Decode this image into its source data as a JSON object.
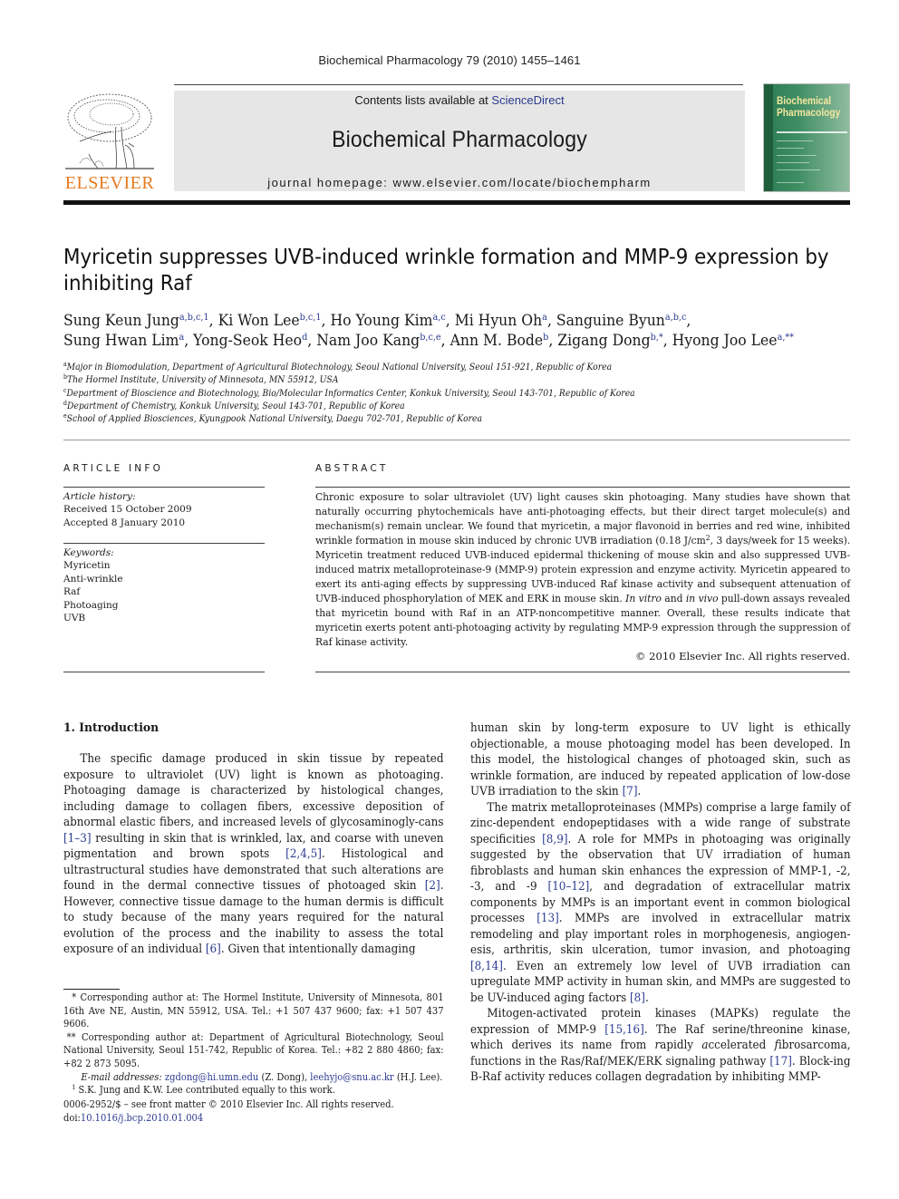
{
  "header": {
    "citation": "Biochemical Pharmacology 79 (2010) 1455–1461",
    "contents_prefix": "Contents lists available at ",
    "contents_link": "ScienceDirect",
    "journal_name": "Biochemical Pharmacology",
    "homepage": "journal homepage: www.elsevier.com/locate/biochempharm",
    "publisher_logo_text": "ELSEVIER",
    "cover": {
      "title_line1": "Biochemical",
      "title_line2": "Pharmacology"
    }
  },
  "colors": {
    "link": "#2b3a8f",
    "elsevier_orange": "#e67a1e",
    "masthead_band": "#e6e6e6",
    "cover_green": "#3f8e63"
  },
  "article": {
    "title": "Myricetin suppresses UVB-induced wrinkle formation and MMP-9 expression by inhibiting Raf",
    "authors": [
      {
        "name": "Sung Keun Jung",
        "sup": "a,b,c,1"
      },
      {
        "name": "Ki Won Lee",
        "sup": "b,c,1"
      },
      {
        "name": "Ho Young Kim",
        "sup": "a,c"
      },
      {
        "name": "Mi Hyun Oh",
        "sup": "a"
      },
      {
        "name": "Sanguine Byun",
        "sup": "a,b,c"
      },
      {
        "name": "Sung Hwan Lim",
        "sup": "a"
      },
      {
        "name": "Yong-Seok Heo",
        "sup": "d"
      },
      {
        "name": "Nam Joo Kang",
        "sup": "b,c,e"
      },
      {
        "name": "Ann M. Bode",
        "sup": "b"
      },
      {
        "name": "Zigang Dong",
        "sup": "b,*"
      },
      {
        "name": "Hyong Joo Lee",
        "sup": "a,**"
      }
    ],
    "affiliations": [
      {
        "key": "a",
        "text": "Major in Biomodulation, Department of Agricultural Biotechnology, Seoul National University, Seoul 151-921, Republic of Korea"
      },
      {
        "key": "b",
        "text": "The Hormel Institute, University of Minnesota, MN 55912, USA"
      },
      {
        "key": "c",
        "text": "Department of Bioscience and Biotechnology, Bio/Molecular Informatics Center, Konkuk University, Seoul 143-701, Republic of Korea"
      },
      {
        "key": "d",
        "text": "Department of Chemistry, Konkuk University, Seoul 143-701, Republic of Korea"
      },
      {
        "key": "e",
        "text": "School of Applied Biosciences, Kyungpook National University, Daegu 702-701, Republic of Korea"
      }
    ]
  },
  "article_info": {
    "heading": "ARTICLE INFO",
    "history_label": "Article history:",
    "received": "Received 15 October 2009",
    "accepted": "Accepted 8 January 2010",
    "keywords_label": "Keywords:",
    "keywords": [
      "Myricetin",
      "Anti-wrinkle",
      "Raf",
      "Photoaging",
      "UVB"
    ]
  },
  "abstract": {
    "heading": "ABSTRACT",
    "part1": "Chronic exposure to solar ultraviolet (UV) light causes skin photoaging. Many studies have shown that naturally occurring phytochemicals have anti-photoaging effects, but their direct target molecule(s) and mechanism(s) remain unclear. We found that myricetin, a major flavonoid in berries and red wine, inhibited wrinkle formation in mouse skin induced by chronic UVB irradiation (0.18 J/cm",
    "sup": "2",
    "part2": ", 3 days/week for 15 weeks). Myricetin treatment reduced UVB-induced epidermal thickening of mouse skin and also suppressed UVB-induced matrix metalloproteinase-9 (MMP-9) protein expression and enzyme activity. Myricetin appeared to exert its anti-aging effects by suppressing UVB-induced Raf kinase activity and subsequent attenuation of UVB-induced phosphorylation of MEK and ERK in mouse skin. ",
    "italic1": "In vitro",
    "and": " and ",
    "italic2": "in vivo",
    "part3": " pull-down assays revealed that myricetin bound with Raf in an ATP-noncompetitive manner. Overall, these results indicate that myricetin exerts potent anti-photoaging activity by regulating MMP-9 expression through the suppression of Raf kinase activity.",
    "copyright": "© 2010 Elsevier Inc. All rights reserved."
  },
  "body": {
    "section_heading": "1. Introduction",
    "left_para": [
      {
        "t": "The specific damage produced in skin tissue by repeated exposure to ultraviolet (UV) light is known as photoaging. Photoaging damage is characterized by histological changes, including damage to collagen fibers, excessive deposition of abnormal elastic fibers, and increased levels of glycosaminogly-cans "
      },
      {
        "ref": "[1–3]"
      },
      {
        "t": " resulting in skin that is wrinkled, lax, and coarse with uneven pigmentation and brown spots "
      },
      {
        "ref": "[2,4,5]"
      },
      {
        "t": ". Histological and ultrastructural studies have demonstrated that such alterations are found in the dermal connective tissues of photoaged skin "
      },
      {
        "ref": "[2]"
      },
      {
        "t": ". However, connective tissue damage to the human dermis is difficult to study because of the many years required for the natural evolution of the process and the inability to assess the total exposure of an individual "
      },
      {
        "ref": "[6]"
      },
      {
        "t": ". Given that intentionally damaging"
      }
    ],
    "right_para1": [
      {
        "t": "human skin by long-term exposure to UV light is ethically objectionable, a mouse photoaging model has been developed. In this model, the histological changes of photoaged skin, such as wrinkle formation, are induced by repeated application of low-dose UVB irradiation to the skin "
      },
      {
        "ref": "[7]"
      },
      {
        "t": "."
      }
    ],
    "right_para2": [
      {
        "t": "The matrix metalloproteinases (MMPs) comprise a large family of zinc-dependent endopeptidases with a wide range of substrate specificities "
      },
      {
        "ref": "[8,9]"
      },
      {
        "t": ". A role for MMPs in photoaging was originally suggested by the observation that UV irradiation of human fibroblasts and human skin enhances the expression of MMP-1, -2, -3, and -9 "
      },
      {
        "ref": "[10–12]"
      },
      {
        "t": ", and degradation of extracellular matrix components by MMPs is an important event in common biological processes "
      },
      {
        "ref": "[13]"
      },
      {
        "t": ". MMPs are involved in extracellular matrix remodeling and play important roles in morphogenesis, angiogen-esis, arthritis, skin ulceration, tumor invasion, and photoaging "
      },
      {
        "ref": "[8,14]"
      },
      {
        "t": ". Even an extremely low level of UVB irradiation can upregulate MMP activity in human skin, and MMPs are suggested to be UV-induced aging factors "
      },
      {
        "ref": "[8]"
      },
      {
        "t": "."
      }
    ],
    "right_para3": [
      {
        "t": "Mitogen-activated protein kinases (MAPKs) regulate the expression of MMP-9 "
      },
      {
        "ref": "[15,16]"
      },
      {
        "t": ". The Raf serine/threonine kinase, which derives its name from "
      },
      {
        "i": "r"
      },
      {
        "t": "apidly "
      },
      {
        "i": "a"
      },
      {
        "t": "ccelerated "
      },
      {
        "i": "f"
      },
      {
        "t": "ibrosarcoma, functions in the Ras/Raf/MEK/ERK signaling pathway "
      },
      {
        "ref": "[17]"
      },
      {
        "t": ". Block-ing B-Raf activity reduces collagen degradation by inhibiting MMP-"
      }
    ]
  },
  "footnotes": {
    "star1": "* Corresponding author at: The Hormel Institute, University of Minnesota, 801 16th Ave NE, Austin, MN 55912, USA. Tel.: +1 507 437 9600; fax: +1 507 437 9606.",
    "star2": "** Corresponding author at: Department of Agricultural Biotechnology, Seoul National University, Seoul 151-742, Republic of Korea. Tel.: +82 2 880 4860; fax: +82 2 873 5095.",
    "email_label": "E-mail addresses:",
    "email1": "zgdong@hi.umn.edu",
    "email1_owner": " (Z. Dong), ",
    "email2": "leehyjo@snu.ac.kr",
    "email2_owner": " (H.J. Lee).",
    "equal_marker": "1",
    "equal": "S.K. Jung and K.W. Lee contributed equally to this work."
  },
  "frontmatter": {
    "issn": "0006-2952/$ – see front matter © 2010 Elsevier Inc. All rights reserved.",
    "doi_label": "doi:",
    "doi": "10.1016/j.bcp.2010.01.004"
  }
}
